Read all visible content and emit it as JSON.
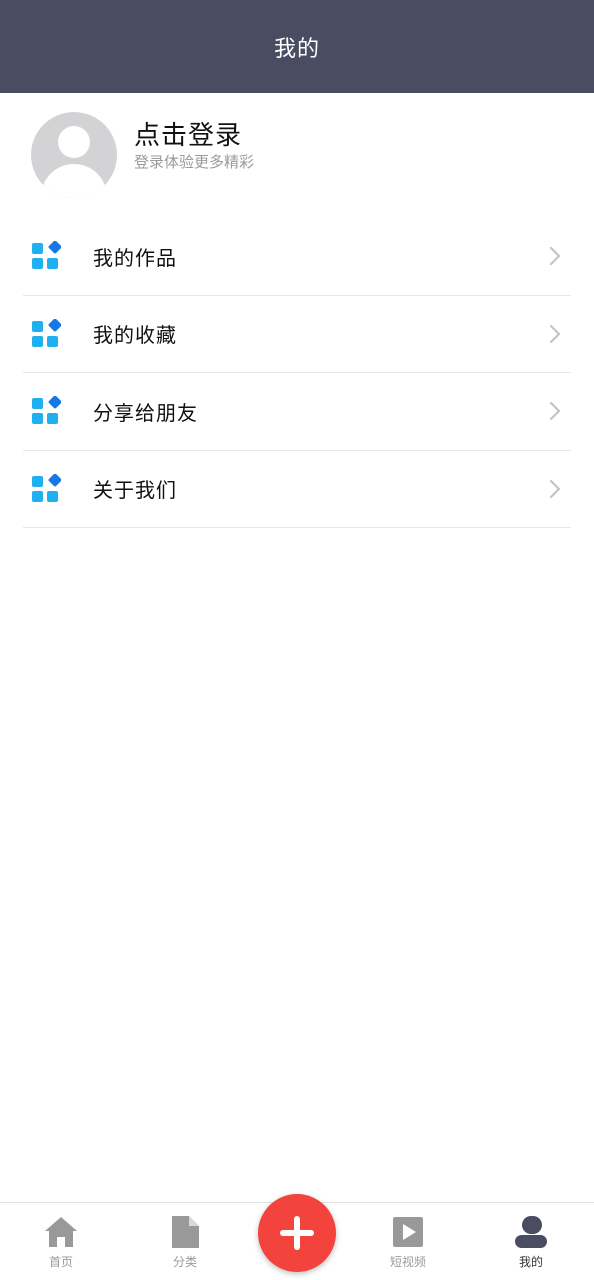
{
  "header": {
    "title": "我的"
  },
  "profile": {
    "login_title": "点击登录",
    "login_subtitle": "登录体验更多精彩",
    "avatar_icon": "default-user-avatar"
  },
  "menu": {
    "items": [
      {
        "label": "我的作品",
        "icon": "grid-diamond-icon"
      },
      {
        "label": "我的收藏",
        "icon": "grid-diamond-icon"
      },
      {
        "label": "分享给朋友",
        "icon": "grid-diamond-icon"
      },
      {
        "label": "关于我们",
        "icon": "grid-diamond-icon"
      }
    ],
    "icon_colors": {
      "square": "#1fb0f0",
      "diamond": "#1677e6"
    },
    "chevron_color": "#c4c4c4"
  },
  "tabbar": {
    "tabs": [
      {
        "label": "首页",
        "icon": "home-icon",
        "active": false
      },
      {
        "label": "分类",
        "icon": "document-icon",
        "active": false
      },
      {
        "label": "短视频",
        "icon": "play-video-icon",
        "active": false
      },
      {
        "label": "我的",
        "icon": "user-icon",
        "active": true
      }
    ],
    "fab_icon": "plus-icon",
    "colors": {
      "inactive_icon": "#999999",
      "active_icon": "#4a4d62",
      "fab": "#f2433c"
    }
  }
}
